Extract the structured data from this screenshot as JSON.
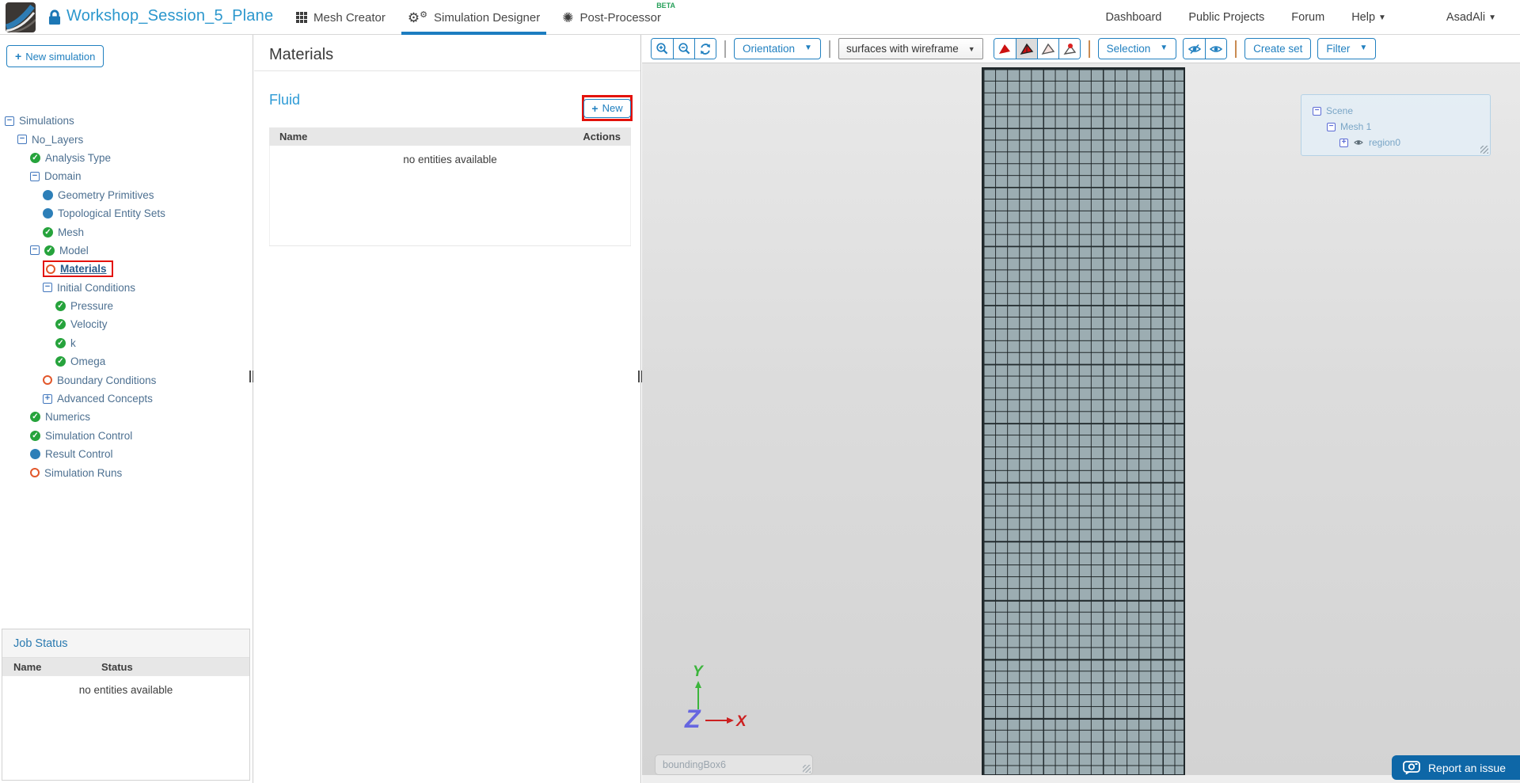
{
  "topbar": {
    "project_title": "Workshop_Session_5_Plane",
    "tabs": [
      {
        "label": "Mesh Creator",
        "active": false
      },
      {
        "label": "Simulation Designer",
        "active": true
      },
      {
        "label": "Post-Processor",
        "active": false,
        "badge": "BETA"
      }
    ],
    "nav": {
      "dashboard": "Dashboard",
      "public_projects": "Public Projects",
      "forum": "Forum",
      "help": "Help",
      "user": "AsadAli"
    }
  },
  "left_panel": {
    "new_simulation_label": "New simulation",
    "tree": [
      {
        "label": "Simulations",
        "level": 0,
        "icons": [
          "collapse"
        ]
      },
      {
        "label": "No_Layers",
        "level": 1,
        "icons": [
          "collapse"
        ]
      },
      {
        "label": "Analysis Type",
        "level": 2,
        "icons": [
          "check"
        ]
      },
      {
        "label": "Domain",
        "level": 2,
        "icons": [
          "collapse"
        ]
      },
      {
        "label": "Geometry Primitives",
        "level": 3,
        "icons": [
          "dot"
        ]
      },
      {
        "label": "Topological Entity Sets",
        "level": 3,
        "icons": [
          "dot"
        ]
      },
      {
        "label": "Mesh",
        "level": 3,
        "icons": [
          "check"
        ]
      },
      {
        "label": "Model",
        "level": 2,
        "icons": [
          "collapse",
          "check"
        ]
      },
      {
        "label": "Materials",
        "level": 3,
        "icons": [
          "ring"
        ],
        "selected": true,
        "annotated": true
      },
      {
        "label": "Initial Conditions",
        "level": 3,
        "icons": [
          "collapse"
        ]
      },
      {
        "label": "Pressure",
        "level": 4,
        "icons": [
          "check"
        ]
      },
      {
        "label": "Velocity",
        "level": 4,
        "icons": [
          "check"
        ]
      },
      {
        "label": "k",
        "level": 4,
        "icons": [
          "check"
        ]
      },
      {
        "label": "Omega",
        "level": 4,
        "icons": [
          "check"
        ]
      },
      {
        "label": "Boundary Conditions",
        "level": 3,
        "icons": [
          "ring"
        ]
      },
      {
        "label": "Advanced Concepts",
        "level": 3,
        "icons": [
          "expand"
        ]
      },
      {
        "label": "Numerics",
        "level": 2,
        "icons": [
          "check"
        ]
      },
      {
        "label": "Simulation Control",
        "level": 2,
        "icons": [
          "check"
        ]
      },
      {
        "label": "Result Control",
        "level": 2,
        "icons": [
          "dot"
        ]
      },
      {
        "label": "Simulation Runs",
        "level": 2,
        "icons": [
          "ring"
        ]
      }
    ],
    "job_status": {
      "title": "Job Status",
      "col_name": "Name",
      "col_status": "Status",
      "empty_text": "no entities available"
    }
  },
  "materials_panel": {
    "title": "Materials",
    "section_title": "Fluid",
    "new_button_label": "New",
    "table": {
      "col_name": "Name",
      "col_actions": "Actions",
      "empty_text": "no entities available"
    }
  },
  "viewport": {
    "toolbar": {
      "orientation_label": "Orientation",
      "render_mode_value": "surfaces with wireframe",
      "selection_label": "Selection",
      "create_set_label": "Create set",
      "filter_label": "Filter"
    },
    "scene_tree": {
      "scene": "Scene",
      "mesh": "Mesh 1",
      "region": "region0"
    },
    "axis_labels": {
      "x": "X",
      "y": "Y",
      "z": "Z"
    },
    "bounding_box_value": "boundingBox6",
    "report_button_label": "Report an issue"
  },
  "colors": {
    "accent_blue": "#2180c0",
    "title_blue": "#2b97cd",
    "annotation_red": "#e3120b",
    "status_done_green": "#26a33c",
    "status_info_blue": "#2d7fb8",
    "status_todo_orange": "#e2572b",
    "beta_green": "#27a05a",
    "mesh_fill": "#9cadb2",
    "axis_x_red": "#cc2020",
    "axis_y_green": "#3cb53c",
    "axis_z_blue": "#6666e0"
  }
}
